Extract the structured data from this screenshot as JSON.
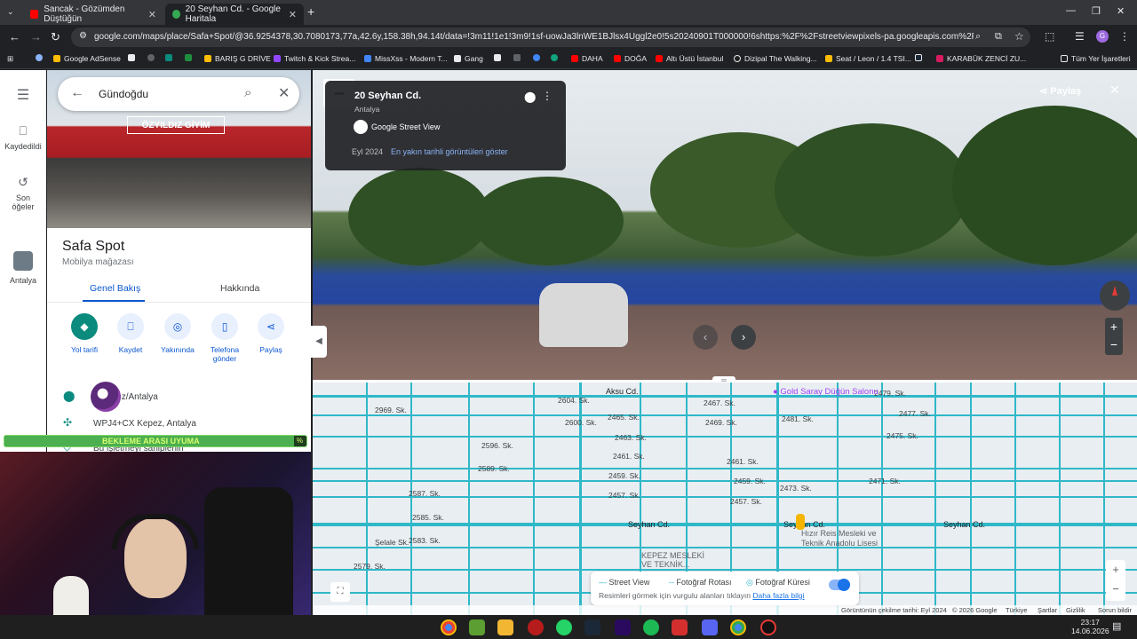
{
  "browser": {
    "tabs": [
      {
        "title": "Sancak - Gözümden Düştüğün"
      },
      {
        "title": "20 Seyhan Cd. - Google Haritala"
      }
    ],
    "url": "google.com/maps/place/Safa+Spot/@36.9254378,30.7080173,77a,42.6y,158.38h,94.14t/data=!3m11!1e1!3m9!1sf-uowJa3lnWE1BJlsx4Uggl2e0!5s20240901T000000!6shttps:%2F%2Fstreetviewpixels-pa.googleapis.com%2Fv1%2Fthumbnail...",
    "bookmarks": [
      "Google AdSense",
      "BARIŞ G DRİVE",
      "Twitch & Kick Strea...",
      "MissXss - Modern T...",
      "Gang",
      "DAHA",
      "DOĞA",
      "Altı Üstü İstanbul",
      "Dizipal The Walking...",
      "Seat / Leon / 1.4 TSI...",
      "KARABÜK ZENCİ ZU..."
    ],
    "all_bookmarks": "Tüm Yer İşaretleri",
    "profile_initial": "G"
  },
  "rail": {
    "saved": "Kaydedildi",
    "recent_line1": "Son",
    "recent_line2": "öğeler",
    "recent_place": "Antalya"
  },
  "search": {
    "value": "Gündoğdu"
  },
  "place": {
    "hero_sign": "ÖZYILDIZ GİYİM",
    "name": "Safa Spot",
    "category": "Mobilya mağazası",
    "tabs": [
      "Genel Bakış",
      "Hakkında"
    ],
    "actions": [
      "Yol tarifi",
      "Kaydet",
      "Yakınında",
      "Telefona gönder",
      "Paylaş"
    ],
    "address": "...Kepez/Antalya",
    "plus_code": "WPJ4+CX Kepez, Antalya",
    "claim": "Bu işletmeyi sahiplenin"
  },
  "overlay": {
    "progress_label": "BEKLEME ARASI UYUMA",
    "progress_pct": "%",
    "progress_fraction": 0.96
  },
  "streetview": {
    "title": "20 Seyhan Cd.",
    "subtitle": "Antalya",
    "brand": "Google Street View",
    "date": "Eyl 2024",
    "dates_link": "En yakın tarihli görüntüleri göster",
    "share": "Paylaş"
  },
  "map": {
    "streets": [
      "Aksu Cd.",
      "Seyhan Cd.",
      "Seyhan Cd.",
      "Seyhan Cd.",
      "Şelale Sk.",
      "2596. Sk.",
      "2589. Sk.",
      "2587. Sk.",
      "2585. Sk.",
      "2583. Sk.",
      "2579. Sk.",
      "2604. Sk.",
      "2600. Sk.",
      "2465. Sk.",
      "2463. Sk.",
      "2461. Sk.",
      "2459. Sk.",
      "2457. Sk.",
      "2467. Sk.",
      "2469. Sk.",
      "2473. Sk.",
      "2475. Sk.",
      "2471. Sk.",
      "2477. Sk.",
      "2479. Sk.",
      "2481. Sk.",
      "2461. Sk.",
      "2459. Sk.",
      "2457. Sk.",
      "2969. Sk."
    ],
    "poi_dugun": "Gold Saray Düğün Salonu",
    "poi_lise_1": "Hızır Reis Mesleki ve",
    "poi_lise_2": "Teknik Anadolu Lisesi",
    "poi_kepez_1": "KEPEZ MESLEKİ",
    "poi_kepez_2": "VE TEKNİK...",
    "legend": {
      "street_view": "Street View",
      "photo_route": "Fotoğraf Rotası",
      "photo_sphere": "Fotoğraf Küresi",
      "note": "Resimleri görmek için vurgulu alanları tıklayın",
      "more": "Daha fazla bilgi"
    },
    "attribution": [
      "Görüntünün çekilme tarihi: Eyl 2024",
      "© 2026 Google",
      "Türkiye",
      "Şartlar",
      "Gizlilik",
      "Sorun bildir"
    ]
  },
  "taskbar": {
    "time": "23:17",
    "date": "14.06.2026"
  },
  "colors": {
    "accent": "#0b57d0",
    "teal": "#0b8a7e",
    "street_view_line": "#2fb8c8"
  }
}
